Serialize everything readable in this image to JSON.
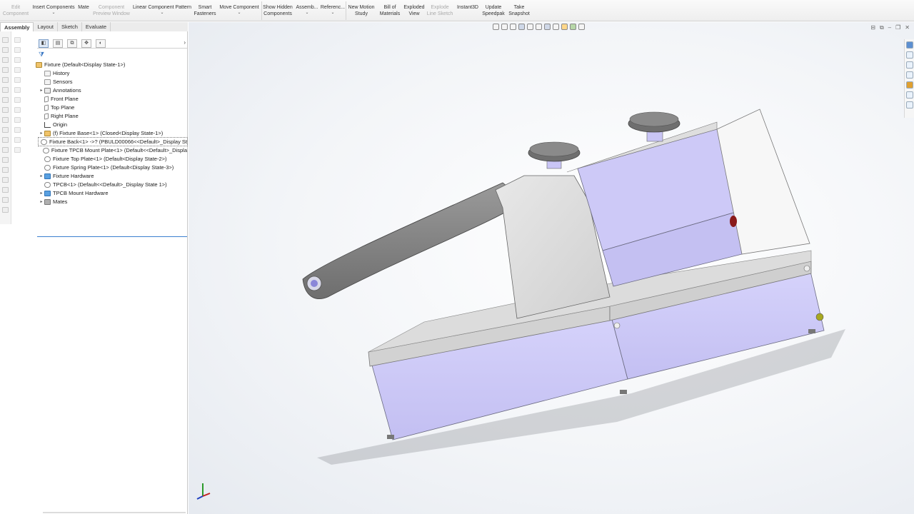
{
  "ribbon": {
    "items": [
      {
        "label": "Edit\nComponent",
        "disabled": true
      },
      {
        "label": "Insert Components",
        "disabled": false
      },
      {
        "label": "Mate",
        "disabled": false
      },
      {
        "label": "Component\nPreview Window",
        "disabled": true
      },
      {
        "label": "Linear Component Pattern",
        "disabled": false
      },
      {
        "label": "Smart\nFasteners",
        "disabled": false
      },
      {
        "label": "Move Component",
        "disabled": false
      },
      {
        "label": "Show Hidden\nComponents",
        "disabled": false
      },
      {
        "label": "Assemb...",
        "disabled": false
      },
      {
        "label": "Referenc...",
        "disabled": false
      },
      {
        "label": "New Motion\nStudy",
        "disabled": false
      },
      {
        "label": "Bill of\nMaterials",
        "disabled": false
      },
      {
        "label": "Exploded\nView",
        "disabled": false
      },
      {
        "label": "Explode\nLine Sketch",
        "disabled": true
      },
      {
        "label": "Instant3D",
        "disabled": false
      },
      {
        "label": "Update\nSpeedpak",
        "disabled": false
      },
      {
        "label": "Take\nSnapshot",
        "disabled": false
      }
    ]
  },
  "command_tabs": [
    "Assembly",
    "Layout",
    "Sketch",
    "Evaluate"
  ],
  "feature_tree": {
    "root": "Fixture  (Default<Display State-1>)",
    "items": [
      {
        "label": "History",
        "icon": "history-icon"
      },
      {
        "label": "Sensors",
        "icon": "sensors-icon"
      },
      {
        "label": "Annotations",
        "icon": "annotations-icon"
      },
      {
        "label": "Front Plane",
        "icon": "plane-icon"
      },
      {
        "label": "Top Plane",
        "icon": "plane-icon"
      },
      {
        "label": "Right Plane",
        "icon": "plane-icon"
      },
      {
        "label": "Origin",
        "icon": "origin-icon"
      },
      {
        "label": "(f) Fixture Base<1> (Closed<Display State-1>)",
        "icon": "subassembly-icon"
      },
      {
        "label": "Fixture Back<1> ->? (PBULD00066<<Default>_Display St",
        "icon": "part-icon"
      },
      {
        "label": "Fixture TPCB Mount Plate<1> (Default<<Default>_Displa",
        "icon": "part-icon"
      },
      {
        "label": "Fixture Top Plate<1> (Default<Display State-2>)",
        "icon": "part-icon"
      },
      {
        "label": "Fixture Spring Plate<1> (Default<Display State-3>)",
        "icon": "part-icon"
      },
      {
        "label": "Fixture Hardware",
        "icon": "folder-icon"
      },
      {
        "label": "TPCB<1> (Default<<Default>_Display State 1>)",
        "icon": "part-icon"
      },
      {
        "label": "TPCB Mount Hardware",
        "icon": "folder-icon"
      },
      {
        "label": "Mates",
        "icon": "mates-icon"
      }
    ]
  },
  "colors": {
    "part_lavender": "#cfcbf7",
    "part_grey": "#d4d4d4",
    "part_dark_grey": "#8e8e8e",
    "knob_grey": "#6d6d6d"
  }
}
